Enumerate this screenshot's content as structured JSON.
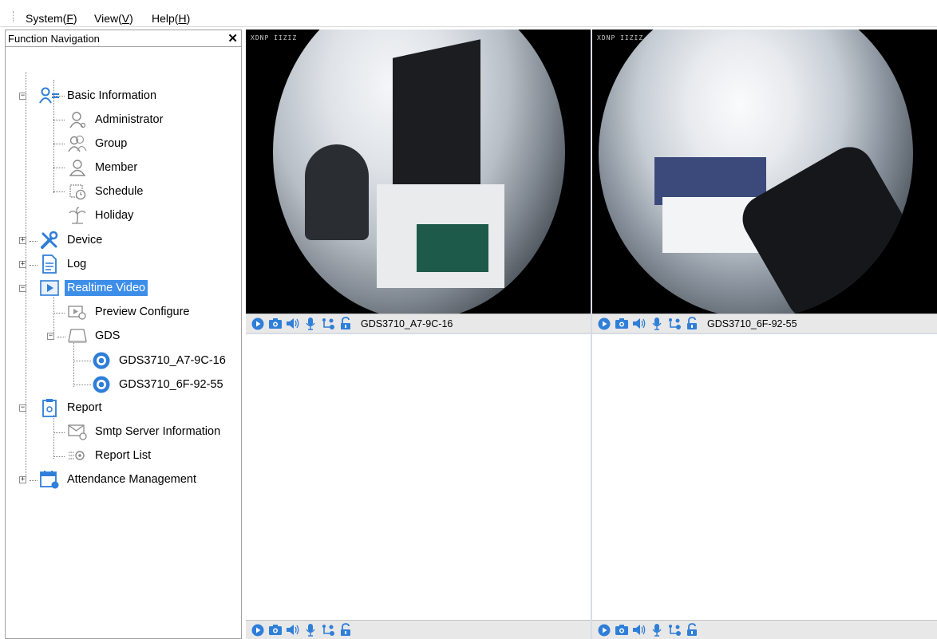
{
  "menu": [
    {
      "label": "System(",
      "key": "F",
      "close": ")"
    },
    {
      "label": "View(",
      "key": "V",
      "close": ")"
    },
    {
      "label": "Help(",
      "key": "H",
      "close": ")"
    }
  ],
  "nav": {
    "title": "Function Navigation",
    "close": "✕",
    "tree": {
      "basic_information": "Basic Information",
      "administrator": "Administrator",
      "group": "Group",
      "member": "Member",
      "schedule": "Schedule",
      "holiday": "Holiday",
      "device": "Device",
      "log": "Log",
      "realtime_video": "Realtime Video",
      "preview_configure": "Preview Configure",
      "gds": "GDS",
      "camera1": "GDS3710_A7-9C-16",
      "camera2": "GDS3710_6F-92-55",
      "report": "Report",
      "smtp_server_information": "Smtp Server Information",
      "report_list": "Report List",
      "attendance_management": "Attendance Management"
    }
  },
  "video": {
    "cells": [
      {
        "name": "GDS3710_A7-9C-16",
        "stamp": "XDNP IIZIZ"
      },
      {
        "name": "GDS3710_6F-92-55",
        "stamp": "XDNP IIZIZ"
      },
      {
        "name": ""
      },
      {
        "name": ""
      }
    ]
  },
  "colors": {
    "accent": "#3d8ee8",
    "icon_blue": "#2f7ed8",
    "selected_cell_border": "#9b1a1a"
  }
}
